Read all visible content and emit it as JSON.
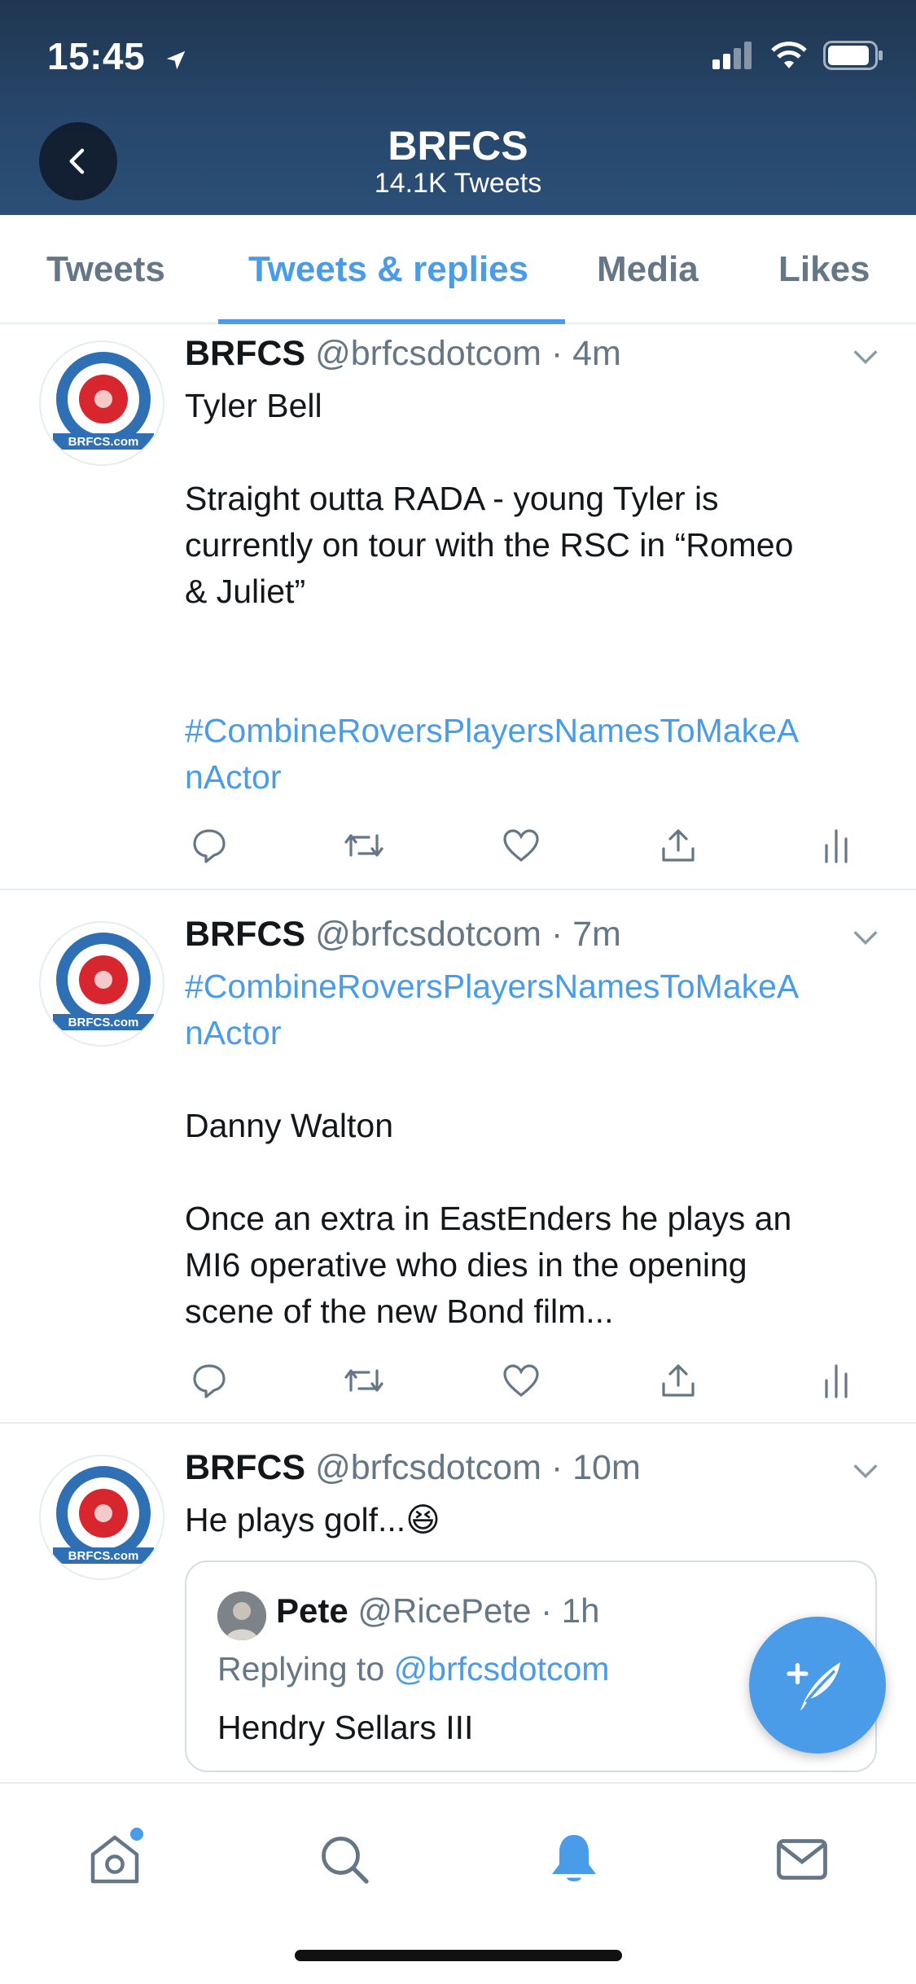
{
  "status_bar": {
    "time": "15:45"
  },
  "header": {
    "title": "BRFCS",
    "subtitle": "14.1K Tweets"
  },
  "tabs": [
    {
      "label": "Tweets"
    },
    {
      "label": "Tweets & replies",
      "active": true
    },
    {
      "label": "Media"
    },
    {
      "label": "Likes"
    }
  ],
  "logo_text": "BRFCS.com",
  "tweets": [
    {
      "name": "BRFCS",
      "handle": "@brfcsdotcom",
      "time": "4m",
      "lines": [
        "Tyler Bell",
        "",
        "Straight outta RADA - young Tyler is",
        "currently on tour with the RSC in “Romeo",
        "& Juliet”",
        "",
        "",
        "#CombineRoversPlayersNamesToMakeA",
        "nActor"
      ]
    },
    {
      "name": "BRFCS",
      "handle": "@brfcsdotcom",
      "time": "7m",
      "lines": [
        "#CombineRoversPlayersNamesToMakeA",
        "nActor",
        "",
        "Danny Walton",
        "",
        "Once an extra in EastEnders he plays an",
        "MI6 operative who dies in the opening",
        "scene of the new Bond film..."
      ]
    },
    {
      "name": "BRFCS",
      "handle": "@brfcsdotcom",
      "time": "10m",
      "lines": [
        "He plays golf...😆"
      ],
      "quote": {
        "name": "Pete",
        "handle": "@RicePete",
        "time": "1h",
        "replying_label": "Replying to",
        "replying_to": "@brfcsdotcom",
        "text": "Hendry Sellars III"
      }
    }
  ],
  "colors": {
    "accent": "#4a9ce8",
    "header": "#27476b",
    "secondary_text": "#657786"
  },
  "icons": {
    "actions": [
      "reply-icon",
      "retweet-icon",
      "like-icon",
      "share-icon",
      "analytics-icon"
    ],
    "nav": [
      "home-icon",
      "search-icon",
      "notifications-bell-icon",
      "messages-envelope-icon"
    ],
    "fab": "compose-tweet-icon"
  }
}
